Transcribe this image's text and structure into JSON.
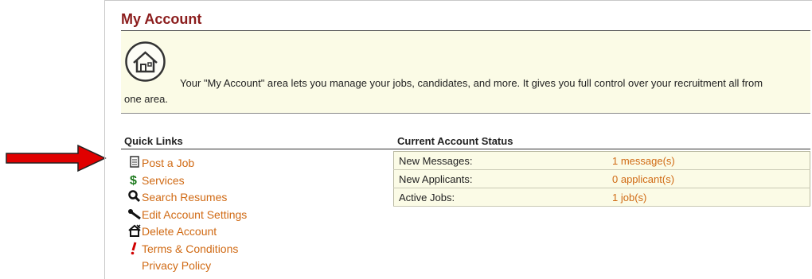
{
  "page": {
    "title": "My Account",
    "intro_text": "Your \"My Account\" area lets you manage your jobs, candidates, and more. It gives you full control over your recruitment all from one area."
  },
  "quick_links": {
    "title": "Quick Links",
    "items": [
      {
        "label": "Post a Job",
        "icon": "document-icon"
      },
      {
        "label": "Services",
        "icon": "dollar-icon"
      },
      {
        "label": "Search Resumes",
        "icon": "magnifier-icon"
      },
      {
        "label": "Edit Account Settings",
        "icon": "wrench-icon"
      },
      {
        "label": "Delete Account",
        "icon": "house-delete-icon"
      },
      {
        "label": "Terms & Conditions",
        "icon": "exclamation-icon"
      },
      {
        "label": "Privacy Policy",
        "icon": ""
      }
    ]
  },
  "account_status": {
    "title": "Current Account Status",
    "rows": [
      {
        "label": "New Messages:",
        "value": "1 message(s)"
      },
      {
        "label": "New Applicants:",
        "value": "0 applicant(s)"
      },
      {
        "label": "Active Jobs:",
        "value": "1 job(s)"
      }
    ]
  },
  "colors": {
    "title": "#8b1c1c",
    "link": "#d06a14",
    "panel_bg": "#fbfbe6",
    "arrow": "#e00000"
  }
}
